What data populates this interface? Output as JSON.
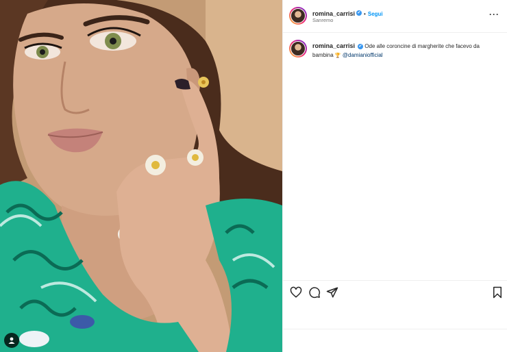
{
  "post": {
    "username": "romina_carrisi",
    "verified_badge": "✔",
    "dot": "•",
    "follow_label": "Segui",
    "location": "Sanremo",
    "more_label": "···",
    "caption_text": "Ode alle coroncine di margherite che facevo da bambina",
    "caption_emoji": "🏆",
    "caption_mention": "@damianiofficial"
  },
  "icons": {
    "like": "heart-icon",
    "comment": "comment-icon",
    "share": "paper-plane-icon",
    "save": "bookmark-icon",
    "tag": "user-tag-icon"
  },
  "colors": {
    "follow": "#0095f6",
    "verified": "#3897f0",
    "mention": "#00376b",
    "divider": "#efefef"
  }
}
